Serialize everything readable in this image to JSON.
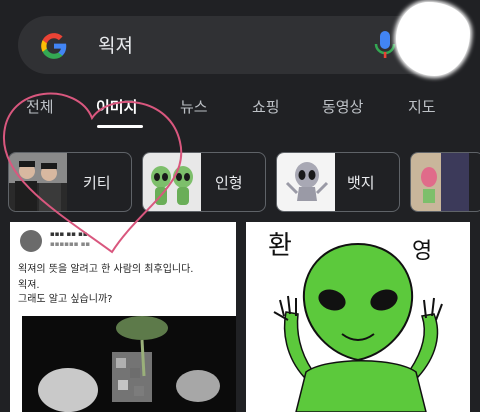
{
  "search": {
    "query": "왹져"
  },
  "tabs": [
    {
      "label": "전체"
    },
    {
      "label": "이미지"
    },
    {
      "label": "뉴스"
    },
    {
      "label": "쇼핑"
    },
    {
      "label": "동영상"
    },
    {
      "label": "지도"
    }
  ],
  "active_tab": "이미지",
  "chips": [
    {
      "label": "키티"
    },
    {
      "label": "인형"
    },
    {
      "label": "뱃지"
    }
  ],
  "results": {
    "tweet": {
      "line1": "왹져의 뜻을 알려고 한 사람의 최후입니다.",
      "line2": "왹져.",
      "line3": "그래도 알고 싶습니까?"
    },
    "alien": {
      "text_left": "환",
      "text_right": "영"
    }
  },
  "colors": {
    "background": "#202124",
    "searchbar": "#303134",
    "accent_underline": "#ffffff",
    "heart_doodle": "#d9577e",
    "alien_green": "#5cc93c"
  }
}
